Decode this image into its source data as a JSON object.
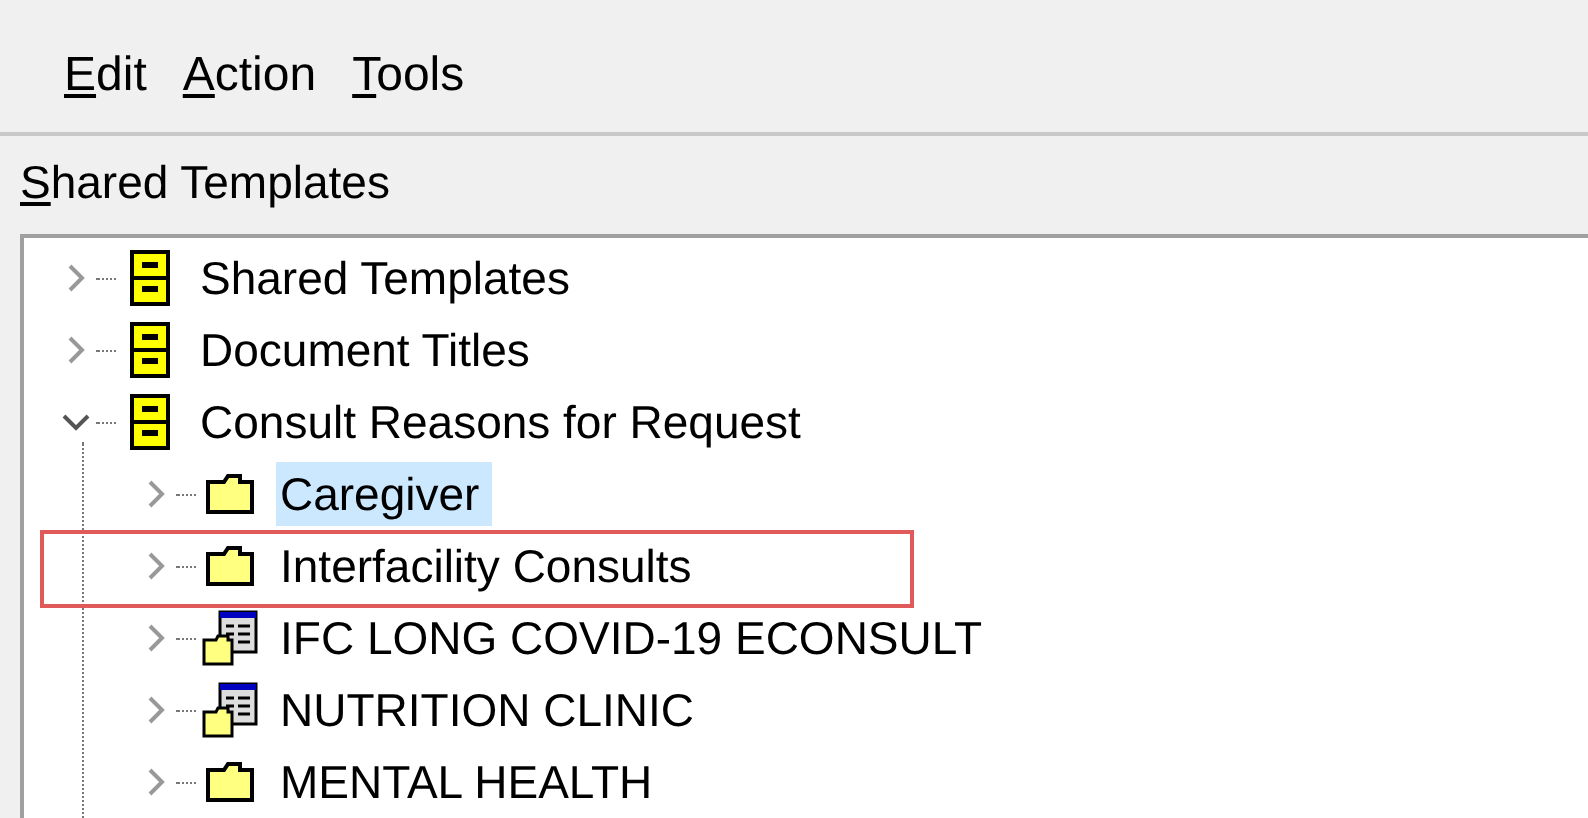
{
  "menu": [
    "Edit",
    "Action",
    "Tools"
  ],
  "panel_title": "Shared Templates",
  "tree": [
    {
      "label": "Shared Templates",
      "kind": "cabinet",
      "expanded": false,
      "selected": false,
      "annotated": false
    },
    {
      "label": "Document Titles",
      "kind": "cabinet",
      "expanded": false,
      "selected": false,
      "annotated": false
    },
    {
      "label": "Consult Reasons for Request",
      "kind": "cabinet",
      "expanded": true,
      "selected": false,
      "annotated": false,
      "children": [
        {
          "label": "Caregiver",
          "kind": "folder",
          "expanded": false,
          "selected": true,
          "annotated": false
        },
        {
          "label": "Interfacility Consults",
          "kind": "folder",
          "expanded": false,
          "selected": false,
          "annotated": true
        },
        {
          "label": "IFC LONG COVID-19 ECONSULT",
          "kind": "template",
          "expanded": false,
          "selected": false,
          "annotated": false
        },
        {
          "label": "NUTRITION CLINIC",
          "kind": "template",
          "expanded": false,
          "selected": false,
          "annotated": false
        },
        {
          "label": "MENTAL HEALTH",
          "kind": "folder",
          "expanded": false,
          "selected": false,
          "annotated": false
        }
      ]
    }
  ]
}
